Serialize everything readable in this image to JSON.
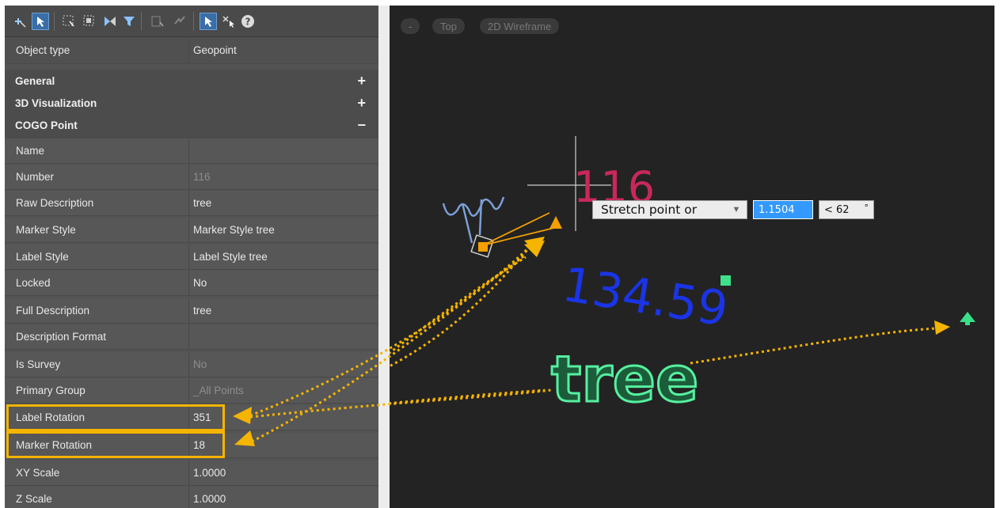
{
  "properties": {
    "object_type": {
      "key": "Object type",
      "value": "Geopoint"
    },
    "categories": [
      {
        "label": "General",
        "toggle": "+"
      },
      {
        "label": "3D Visualization",
        "toggle": "+"
      },
      {
        "label": "COGO Point",
        "toggle": "−"
      }
    ],
    "rows": [
      {
        "key": "Name",
        "value": ""
      },
      {
        "key": "Number",
        "value": "116"
      },
      {
        "key": "Raw Description",
        "value": "tree"
      },
      {
        "key": "Marker Style",
        "value": "Marker Style tree"
      },
      {
        "key": "Label Style",
        "value": "Label Style tree"
      },
      {
        "key": "Locked",
        "value": "No"
      },
      {
        "key": "Full Description",
        "value": "tree"
      },
      {
        "key": "Description Format",
        "value": ""
      },
      {
        "key": "Is Survey",
        "value": "No"
      },
      {
        "key": "Primary Group",
        "value": "_All Points"
      },
      {
        "key": "Label Rotation",
        "value": "351"
      },
      {
        "key": "Marker Rotation",
        "value": "18"
      },
      {
        "key": "XY Scale",
        "value": "1.0000"
      },
      {
        "key": "Z Scale",
        "value": "1.0000"
      }
    ],
    "toolbar_icons": [
      "add-selection-icon",
      "select-objects-icon",
      "quick-select-icon",
      "select-similar-icon",
      "toggle-pickadd-icon",
      "filter-icon",
      "object-list-icon",
      "edit-icon",
      "select-cursor-icon",
      "deselect-icon",
      "help-icon"
    ]
  },
  "viewport": {
    "controls": [
      "-",
      "Top",
      "2D Wireframe"
    ],
    "point_number": "116",
    "elevation": "134.59",
    "description": "tree",
    "prompt": {
      "label": "Stretch point or",
      "distance": "1.1504",
      "angle": "< 62",
      "angle_mark": "°"
    }
  },
  "colors": {
    "panel_bg": "#535353",
    "viewport_bg": "#232323",
    "highlight": "#f5b400",
    "number_label": "#c8285a",
    "elevation_label": "#1a34e6",
    "description_label": "#2ee87f",
    "grip": "#f5a000",
    "arrow": "#f5b400"
  }
}
